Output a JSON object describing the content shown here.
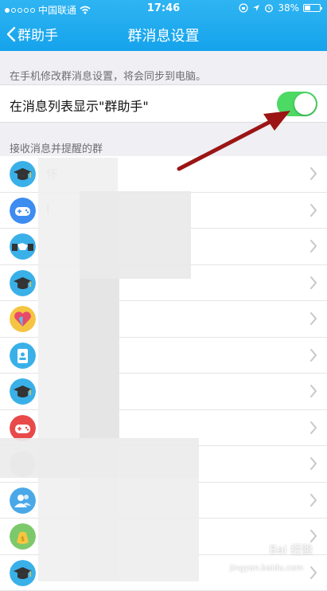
{
  "status_bar": {
    "carrier": "中国联通",
    "time": "17:46",
    "battery": "38%",
    "battery_level": 0.38
  },
  "nav": {
    "back_label": "群助手",
    "title": "群消息设置"
  },
  "hint": "在手机修改群消息设置，将会同步到电脑。",
  "toggle": {
    "label": "在消息列表显示\"群助手\"",
    "on": true
  },
  "section_title": "接收消息并提醒的群",
  "groups": [
    {
      "name": "怀",
      "icon": "graduation-cap-icon",
      "color": "#3ab0e8"
    },
    {
      "name": "I",
      "icon": "gamepad-icon",
      "color": "#3d8cf0"
    },
    {
      "name": "",
      "icon": "handshake-icon",
      "color": "#3ab0e8"
    },
    {
      "name": "",
      "icon": "graduation-cap-icon",
      "color": "#3ab0e8"
    },
    {
      "name": "",
      "icon": "heart-icon",
      "color": "#f5c542"
    },
    {
      "name": "",
      "icon": "id-badge-icon",
      "color": "#3ab0e8"
    },
    {
      "name": "",
      "icon": "graduation-cap-icon",
      "color": "#3ab0e8"
    },
    {
      "name": "",
      "icon": "gamepad-icon",
      "color": "#e84a4a"
    },
    {
      "name": "",
      "icon": "blurred-avatar-icon",
      "color": "#cfcfcf"
    },
    {
      "name": "",
      "icon": "people-icon",
      "color": "#4aa8e8"
    },
    {
      "name": "",
      "icon": "money-bag-icon",
      "color": "#7cc96b"
    },
    {
      "name": "",
      "icon": "graduation-cap-icon",
      "color": "#3ab0e8"
    }
  ],
  "watermark": {
    "text": "Bai 经验",
    "sub": "jingyan.baidu.com"
  }
}
